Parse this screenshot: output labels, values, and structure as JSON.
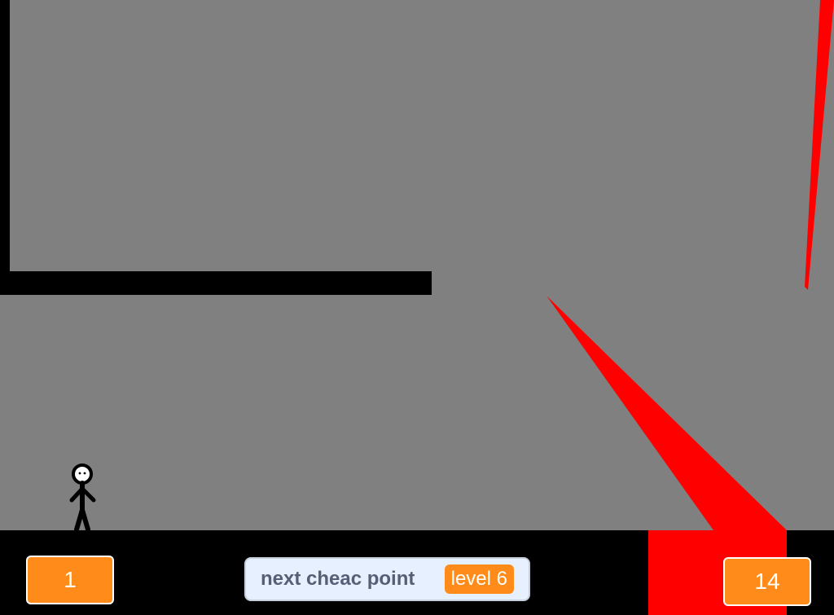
{
  "game": {
    "left_counter": "1",
    "right_counter": "14",
    "checkpoint_label": "next cheac point",
    "checkpoint_value": "level 6"
  },
  "colors": {
    "background": "#808080",
    "walls": "#000000",
    "hazard": "#ff0000",
    "monitor_accent": "#ff8c1a",
    "monitor_bg": "#e6f0ff"
  },
  "icons": {
    "player": "stickman-icon"
  }
}
